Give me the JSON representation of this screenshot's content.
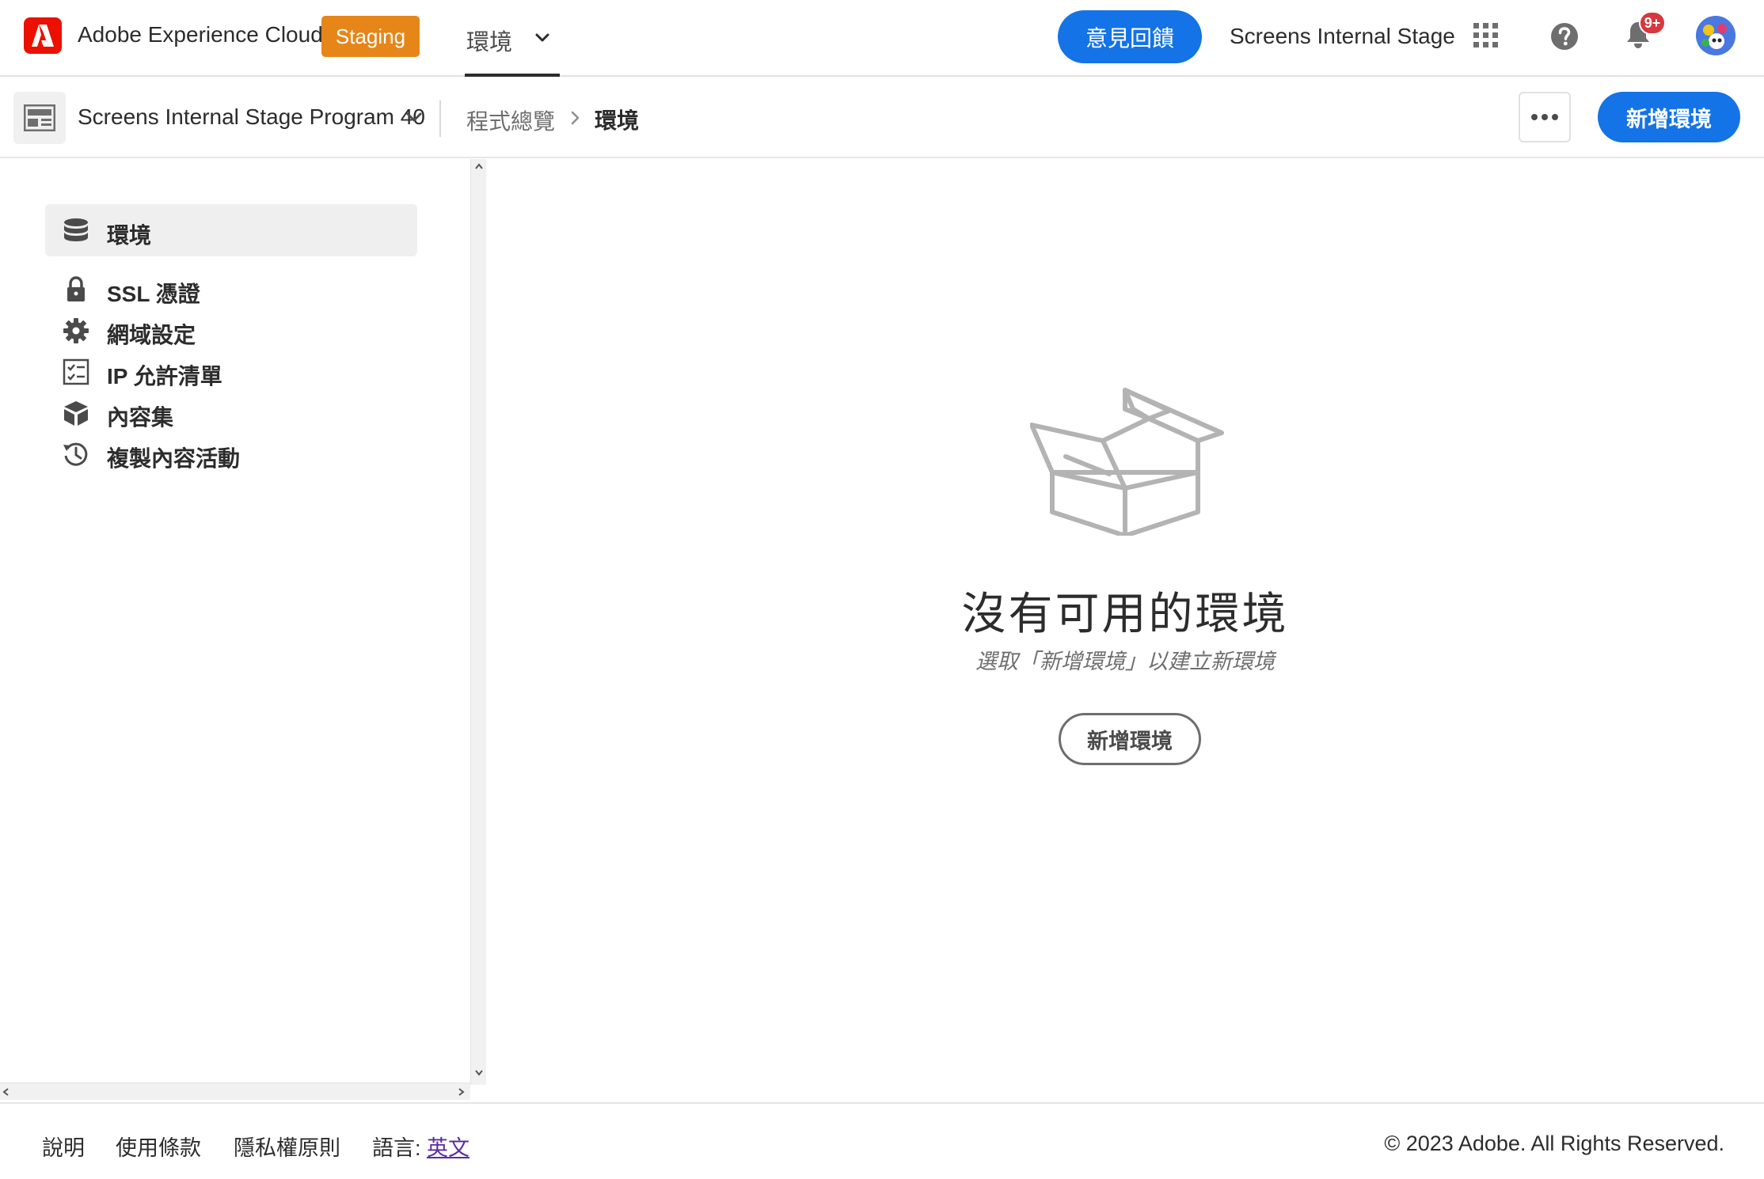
{
  "topbar": {
    "app_name": "Adobe Experience Cloud",
    "badge": "Staging",
    "nav_tab": "環境",
    "feedback_button": "意見回饋",
    "org_name": "Screens Internal Stage",
    "notification_count": "9+",
    "icons": [
      "adobe-logo",
      "apps-grid-icon",
      "help-icon",
      "bell-icon",
      "avatar"
    ],
    "colors": {
      "brand": "#eb1000",
      "staging": "#e68619",
      "primary": "#1473e6"
    }
  },
  "subheader": {
    "program_name": "Screens Internal Stage Program 40",
    "breadcrumb": [
      "程式總覽",
      "環境"
    ],
    "add_button": "新增環境"
  },
  "sidebar": {
    "items": [
      {
        "label": "環境",
        "icon": "database-icon",
        "active": true
      },
      {
        "label": "SSL 憑證",
        "icon": "lock-icon",
        "active": false
      },
      {
        "label": "網域設定",
        "icon": "gear-icon",
        "active": false
      },
      {
        "label": "IP 允許清單",
        "icon": "checklist-icon",
        "active": false
      },
      {
        "label": "內容集",
        "icon": "boxes-icon",
        "active": false
      },
      {
        "label": "複製內容活動",
        "icon": "history-icon",
        "active": false
      }
    ]
  },
  "main": {
    "empty_title": "沒有可用的環境",
    "empty_description": "選取「新增環境」以建立新環境",
    "add_button": "新增環境"
  },
  "footer": {
    "links": [
      "說明",
      "使用條款",
      "隱私權原則"
    ],
    "language_label": "語言: ",
    "language_value": "英文",
    "copyright": "© 2023 Adobe. All Rights Reserved."
  }
}
